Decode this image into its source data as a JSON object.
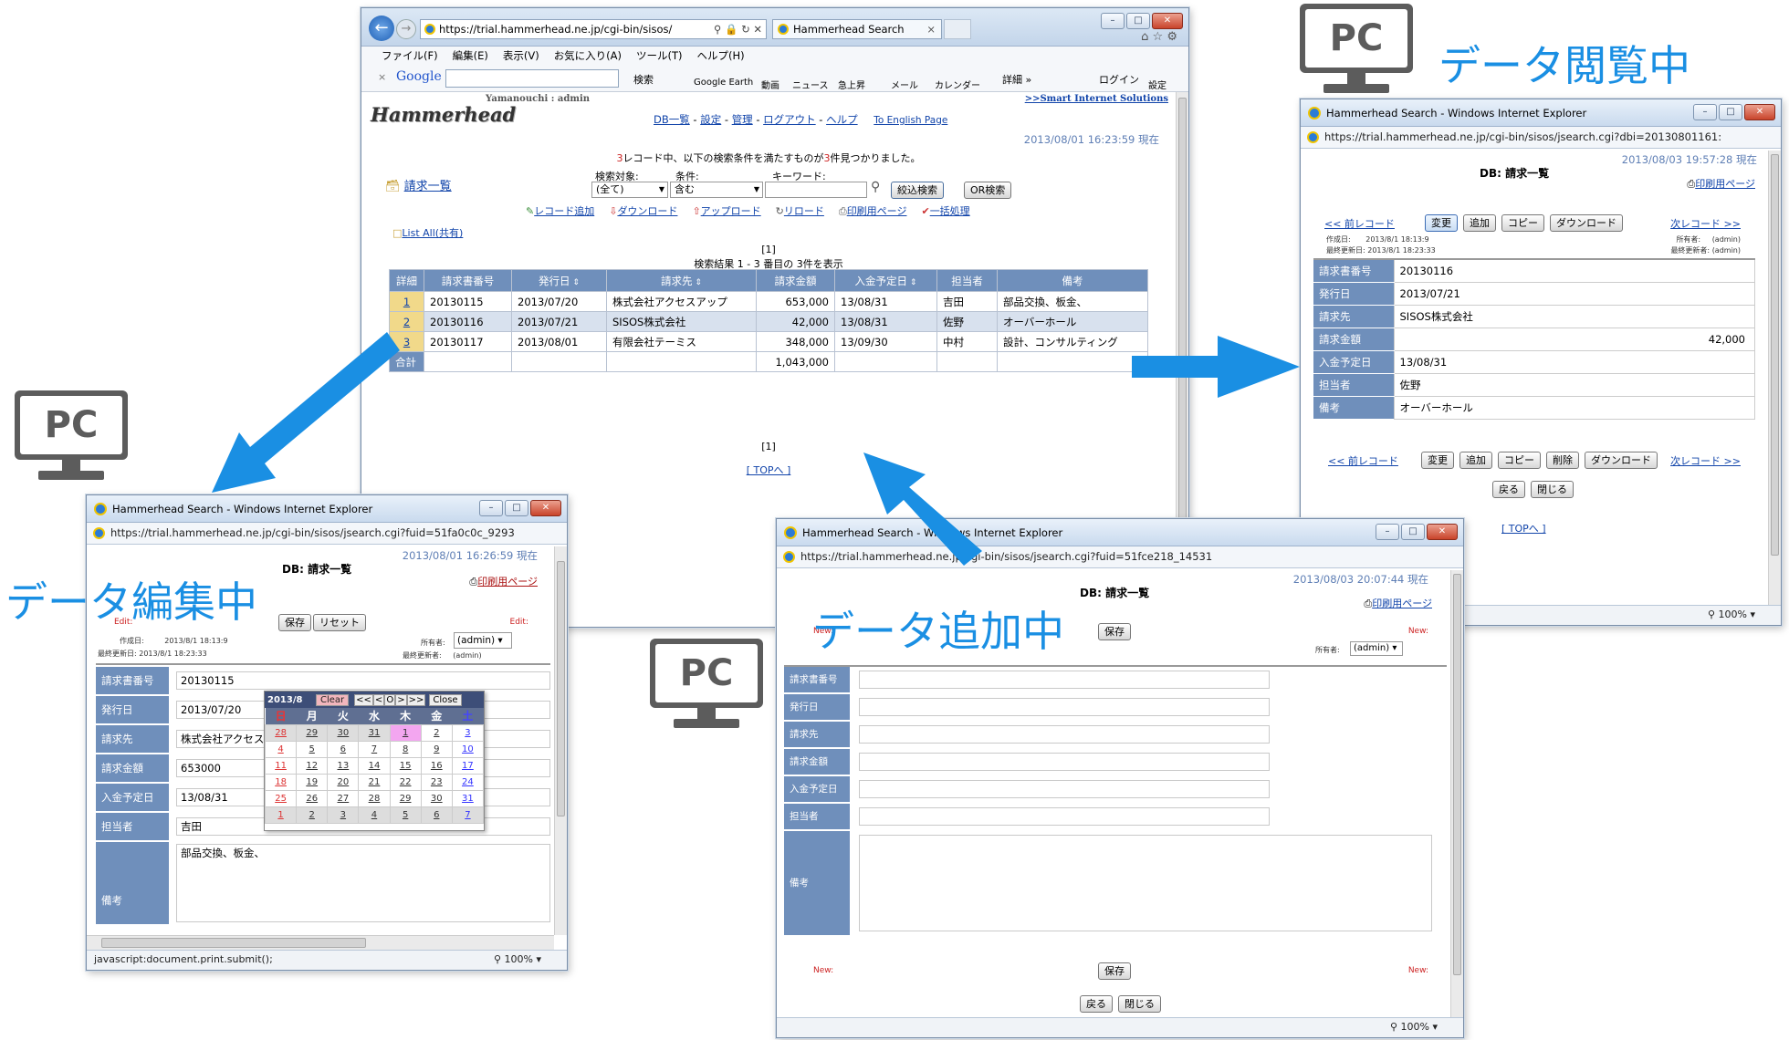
{
  "main": {
    "tab_title": "Hammerhead Search",
    "url": "https://trial.hammerhead.ne.jp/cgi-bin/sisos/",
    "menu": [
      "ファイル(F)",
      "編集(E)",
      "表示(V)",
      "お気に入り(A)",
      "ツール(T)",
      "ヘルプ(H)"
    ],
    "google_logo": "Google",
    "toolbar_items": [
      "検索",
      "Google Earth",
      "動画",
      "ニュース",
      "急上昇",
      "メール",
      "カレンダー",
      "詳細 »"
    ],
    "login_label": "ログイン",
    "settings_label": "設定",
    "logo_text": "Hammerhead",
    "user": "Yamanouchi : admin",
    "smart_link": ">>Smart Internet Solutions",
    "nav": [
      "DB一覧",
      "設定",
      "管理",
      "ログアウト",
      "ヘルプ"
    ],
    "english_link": "To English Page",
    "timestamp": "2013/08/01 16:23:59 現在",
    "result_msg_pre": "3",
    "result_msg": "レコード中、以下の検索条件を満たすものが",
    "result_msg_count": "3",
    "result_msg_post": "件見つかりました。",
    "db_title": "請求一覧",
    "search_target_label": "検索対象:",
    "search_target_value": "(全て)",
    "condition_label": "条件:",
    "condition_value": "含む",
    "keyword_label": "キーワード:",
    "narrow_button": "絞込検索",
    "or_button": "OR検索",
    "actions": [
      "レコード追加",
      "ダウンロード",
      "アップロード",
      "リロード",
      "印刷用ページ",
      "一括処理"
    ],
    "list_all": "List All(共有)",
    "page_indicator": "[1]",
    "result_range": "検索結果 1 - 3 番目の 3件を表示",
    "columns": [
      "詳細",
      "請求書番号",
      "発行日",
      "請求先",
      "請求金額",
      "入金予定日",
      "担当者",
      "備考"
    ],
    "rows": [
      [
        "1",
        "20130115",
        "2013/07/20",
        "株式会社アクセスアップ",
        "653,000",
        "13/08/31",
        "吉田",
        "部品交換、板金、"
      ],
      [
        "2",
        "20130116",
        "2013/07/21",
        "SISOS株式会社",
        "42,000",
        "13/08/31",
        "佐野",
        "オーバーホール"
      ],
      [
        "3",
        "20130117",
        "2013/08/01",
        "有限会社テーミス",
        "348,000",
        "13/09/30",
        "中村",
        "設計、コンサルティング"
      ]
    ],
    "total_label": "合計",
    "total_value": "1,043,000",
    "top_link": "[ TOPへ ]"
  },
  "view": {
    "title": "Hammerhead Search - Windows Internet Explorer",
    "url": "https://trial.hammerhead.ne.jp/cgi-bin/sisos/jsearch.cgi?dbi=20130801161:",
    "timestamp": "2013/08/03 19:57:28 現在",
    "db_title": "DB: 請求一覧",
    "print_link": "印刷用ページ",
    "prev": "<< 前レコード",
    "next": "次レコード >>",
    "buttons_top": [
      "変更",
      "追加",
      "コピー",
      "ダウンロード"
    ],
    "buttons_bottom": [
      "変更",
      "追加",
      "コピー",
      "削除",
      "ダウンロード"
    ],
    "created_label": "作成日:",
    "created": "2013/8/1 18:13:9",
    "updated_label": "最終更新日:",
    "updated": "2013/8/1 18:23:33",
    "owner_label": "所有者:",
    "owner": "(admin)",
    "updater_label": "最終更新者:",
    "updater": "(admin)",
    "fields": [
      {
        "label": "請求書番号",
        "value": "20130116"
      },
      {
        "label": "発行日",
        "value": "2013/07/21"
      },
      {
        "label": "請求先",
        "value": "SISOS株式会社"
      },
      {
        "label": "請求金額",
        "value": "42,000"
      },
      {
        "label": "入金予定日",
        "value": "13/08/31"
      },
      {
        "label": "担当者",
        "value": "佐野"
      },
      {
        "label": "備考",
        "value": "オーバーホール"
      }
    ],
    "back": "戻る",
    "close": "閉じる",
    "top_link": "[ TOPへ ]",
    "zoom": "100%"
  },
  "edit": {
    "title": "Hammerhead Search - Windows Internet Explorer",
    "url": "https://trial.hammerhead.ne.jp/cgi-bin/sisos/jsearch.cgi?fuid=51fa0c0c_9293",
    "timestamp": "2013/08/01 16:26:59 現在",
    "db_title": "DB: 請求一覧",
    "print_link": "印刷用ページ",
    "edit_mark": "Edit:",
    "save": "保存",
    "reset": "リセット",
    "created_label": "作成日:",
    "created": "2013/8/1 18:13:9",
    "updated_label": "最終更新日:",
    "updated": "2013/8/1 18:23:33",
    "owner_label": "所有者:",
    "owner": "(admin)",
    "updater_label": "最終更新者:",
    "updater": "(admin)",
    "fields": [
      {
        "label": "請求書番号",
        "value": "20130115"
      },
      {
        "label": "発行日",
        "value": "2013/07/20"
      },
      {
        "label": "請求先",
        "value": "株式会社アクセス"
      },
      {
        "label": "請求金額",
        "value": "653000"
      },
      {
        "label": "入金予定日",
        "value": "13/08/31"
      },
      {
        "label": "担当者",
        "value": "吉田"
      }
    ],
    "notes_label": "備考",
    "notes_value": "部品交換、板金、",
    "status": "javascript:document.print.submit();",
    "zoom": "100%",
    "calendar": {
      "month": "2013/8",
      "clear": "Clear",
      "nav": [
        "<<",
        "<",
        "O",
        ">",
        ">>"
      ],
      "close": "Close",
      "weekdays": [
        "日",
        "月",
        "火",
        "水",
        "木",
        "金",
        "土"
      ],
      "weeks": [
        [
          "28",
          "29",
          "30",
          "31",
          "1",
          "2",
          "3"
        ],
        [
          "4",
          "5",
          "6",
          "7",
          "8",
          "9",
          "10"
        ],
        [
          "11",
          "12",
          "13",
          "14",
          "15",
          "16",
          "17"
        ],
        [
          "18",
          "19",
          "20",
          "21",
          "22",
          "23",
          "24"
        ],
        [
          "25",
          "26",
          "27",
          "28",
          "29",
          "30",
          "31"
        ],
        [
          "1",
          "2",
          "3",
          "4",
          "5",
          "6",
          "7"
        ]
      ]
    }
  },
  "add": {
    "title": "Hammerhead Search - Windows Internet Explorer",
    "url": "https://trial.hammerhead.ne.jp/cgi-bin/sisos/jsearch.cgi?fuid=51fce218_14531",
    "timestamp": "2013/08/03 20:07:44 現在",
    "db_title": "DB: 請求一覧",
    "print_link": "印刷用ページ",
    "new_mark": "New:",
    "save": "保存",
    "owner_label": "所有者:",
    "owner": "(admin)",
    "labels": [
      "請求書番号",
      "発行日",
      "請求先",
      "請求金額",
      "入金予定日",
      "担当者",
      "備考"
    ],
    "back": "戻る",
    "close": "閉じる",
    "zoom": "100%"
  },
  "captions": {
    "viewing": "データ閲覧中",
    "editing": "データ編集中",
    "adding": "データ追加中",
    "pc": "PC"
  },
  "colors": {
    "arrow": "#1a8fe3",
    "header": "#6f8fbb",
    "caption": "#1a8fe3"
  }
}
